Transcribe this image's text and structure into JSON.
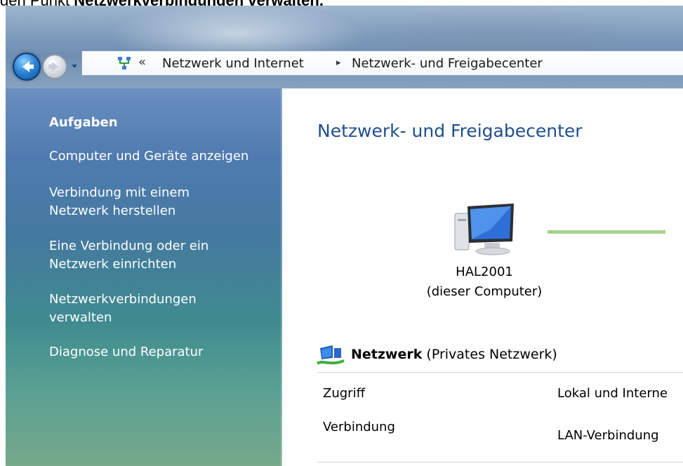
{
  "caption": {
    "prefix": "den Punkt ",
    "bold": "Netzwerkverbindungen verwalten."
  },
  "address_bar": {
    "overflow": "«",
    "crumbs": [
      "Netzwerk und Internet",
      "Netzwerk- und Freigabecenter"
    ],
    "separator": "▸"
  },
  "sidebar": {
    "title": "Aufgaben",
    "links": [
      [
        "Computer und Geräte anzeigen"
      ],
      [
        "Verbindung mit einem",
        "Netzwerk herstellen"
      ],
      [
        "Eine Verbindung oder ein",
        "Netzwerk einrichten"
      ],
      [
        "Netzwerkverbindungen",
        "verwalten"
      ],
      [
        "Diagnose und Reparatur"
      ]
    ]
  },
  "main": {
    "title": "Netzwerk- und Freigabecenter",
    "computer": {
      "name": "HAL2001",
      "subtitle": "(dieser Computer)"
    },
    "network": {
      "name": "Netzwerk",
      "type": "(Privates Netzwerk)"
    },
    "rows": [
      {
        "label": "Zugriff",
        "value": "Lokal und Interne"
      },
      {
        "label": "Verbindung",
        "value": "LAN-Verbindung"
      }
    ]
  },
  "colors": {
    "title_blue": "#1e4f8c",
    "connection_line": "#a9d28c",
    "sidebar_top": "#6a8fc0",
    "sidebar_bottom": "#76a98a"
  },
  "icons": [
    "back-arrow-icon",
    "forward-arrow-icon",
    "recent-pages-dropdown-icon",
    "network-location-icon",
    "computer-icon",
    "network-icon"
  ]
}
